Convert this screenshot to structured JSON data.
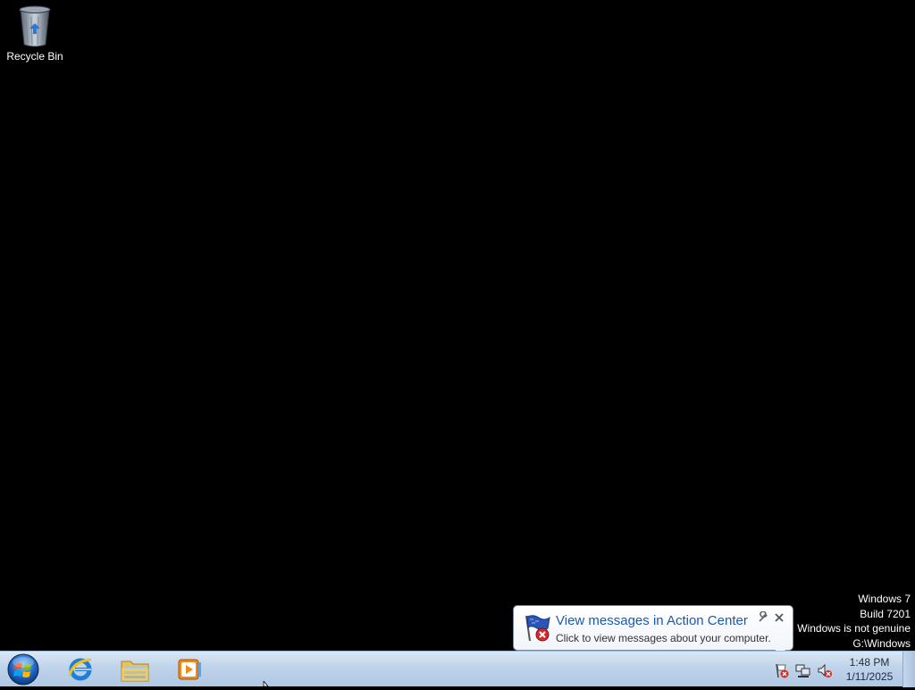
{
  "desktop": {
    "background_color": "#000000",
    "icons": [
      {
        "label": "Recycle Bin",
        "icon": "recycle-bin-icon"
      }
    ]
  },
  "watermark": {
    "line1": "Windows 7",
    "line2": "Build 7201",
    "line3": "Windows is not genuine",
    "line4": "G:\\Windows"
  },
  "notification": {
    "icon": "action-center-flag-error-icon",
    "title": "View messages in Action Center",
    "message": "Click to view messages about your computer.",
    "options_icon": "wrench-icon",
    "close_icon": "close-icon"
  },
  "taskbar": {
    "start_icon": "windows-start-orb-icon",
    "pinned": [
      {
        "name": "Internet Explorer",
        "icon": "internet-explorer-icon"
      },
      {
        "name": "Windows Explorer",
        "icon": "folder-libraries-icon"
      },
      {
        "name": "Windows Media Player",
        "icon": "media-player-icon"
      }
    ],
    "tray": [
      {
        "name": "Action Center",
        "icon": "action-center-flag-error-icon"
      },
      {
        "name": "Network",
        "icon": "network-icon"
      },
      {
        "name": "Volume",
        "icon": "volume-muted-icon"
      }
    ],
    "clock": {
      "time": "1:48 PM",
      "date": "1/11/2025"
    }
  },
  "colors": {
    "taskbar": "#bfd3ea",
    "balloon_title": "#1d5aab",
    "watermark_text": "#ffffff"
  }
}
